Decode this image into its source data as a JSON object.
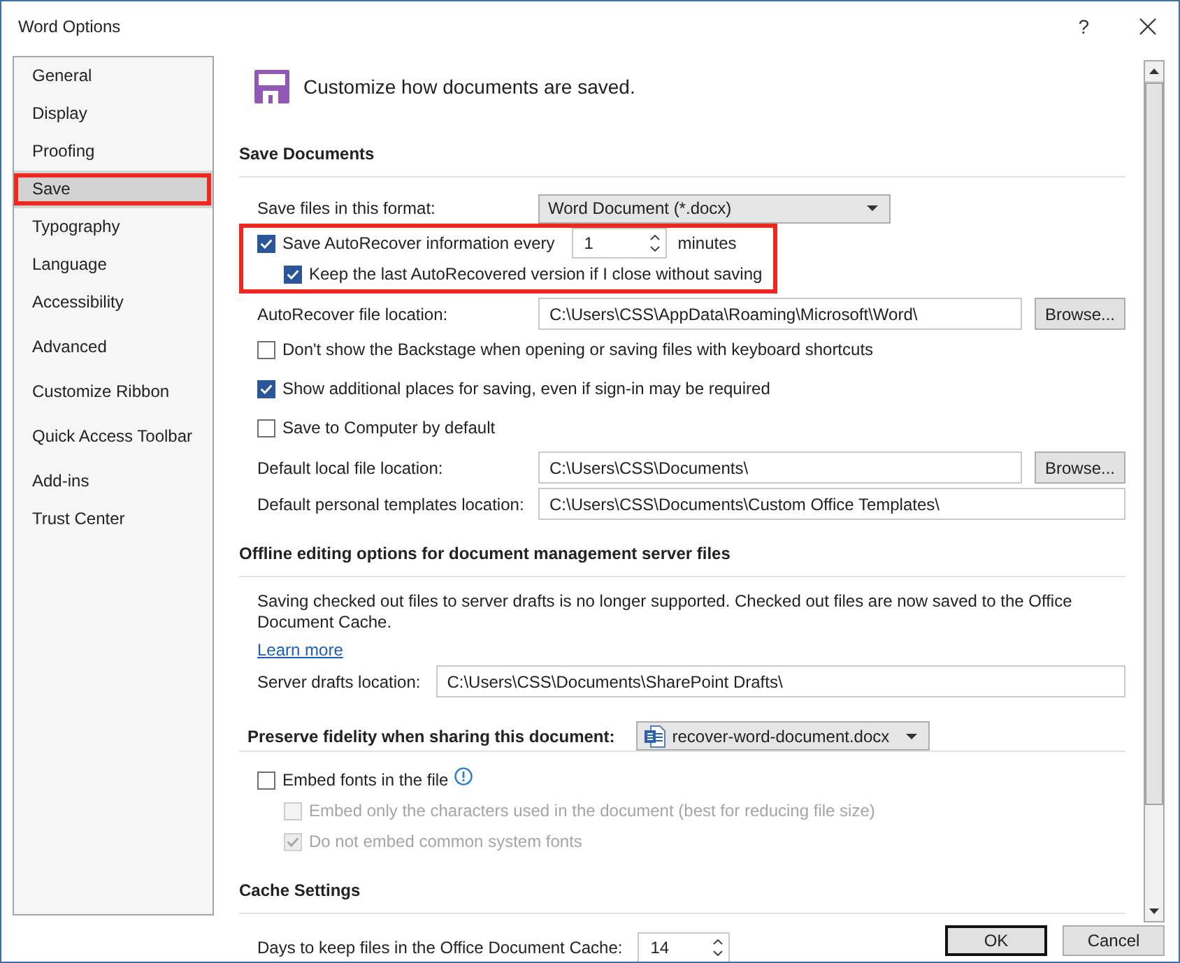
{
  "window": {
    "title": "Word Options",
    "help": "?"
  },
  "sidebar": {
    "groups": [
      {
        "items": [
          {
            "label": "General",
            "selected": false,
            "highlighted": false
          },
          {
            "label": "Display",
            "selected": false,
            "highlighted": false
          },
          {
            "label": "Proofing",
            "selected": false,
            "highlighted": false
          },
          {
            "label": "Save",
            "selected": true,
            "highlighted": true
          },
          {
            "label": "Typography",
            "selected": false,
            "highlighted": false
          },
          {
            "label": "Language",
            "selected": false,
            "highlighted": false
          },
          {
            "label": "Accessibility",
            "selected": false,
            "highlighted": false
          }
        ]
      },
      {
        "items": [
          {
            "label": "Advanced",
            "selected": false,
            "highlighted": false
          }
        ]
      },
      {
        "items": [
          {
            "label": "Customize Ribbon",
            "selected": false,
            "highlighted": false
          }
        ]
      },
      {
        "items": [
          {
            "label": "Quick Access Toolbar",
            "selected": false,
            "highlighted": false
          }
        ]
      },
      {
        "items": [
          {
            "label": "Add-ins",
            "selected": false,
            "highlighted": false
          },
          {
            "label": "Trust Center",
            "selected": false,
            "highlighted": false
          }
        ]
      }
    ]
  },
  "content": {
    "heading": "Customize how documents are saved.",
    "sections": [
      {
        "title": "Save Documents",
        "rows": [
          {
            "kind": "select",
            "label": "Save files in this format:",
            "value": "Word Document (*.docx)"
          },
          {
            "kind": "checkbox",
            "label": "Save AutoRecover information every",
            "checked": true,
            "disabled": false,
            "highlighted": true,
            "spinner": {
              "value": "1",
              "unit": "minutes"
            },
            "children": [
              {
                "kind": "checkbox",
                "label": "Keep the last AutoRecovered version if I close without saving",
                "checked": true,
                "disabled": false
              }
            ]
          },
          {
            "kind": "path",
            "label": "AutoRecover file location:",
            "value": "C:\\Users\\CSS\\AppData\\Roaming\\Microsoft\\Word\\",
            "button": "Browse..."
          },
          {
            "kind": "checkbox",
            "label": "Don't show the Backstage when opening or saving files with keyboard shortcuts",
            "checked": false,
            "disabled": false,
            "highlighted": false
          },
          {
            "kind": "checkbox",
            "label": "Show additional places for saving, even if sign-in may be required",
            "checked": true,
            "disabled": false,
            "highlighted": false
          },
          {
            "kind": "checkbox",
            "label": "Save to Computer by default",
            "checked": false,
            "disabled": false,
            "highlighted": false
          },
          {
            "kind": "path",
            "label": "Default local file location:",
            "value": "C:\\Users\\CSS\\Documents\\",
            "button": "Browse..."
          },
          {
            "kind": "path",
            "label": "Default personal templates location:",
            "value": "C:\\Users\\CSS\\Documents\\Custom Office Templates\\"
          }
        ]
      },
      {
        "title": "Offline editing options for document management server files",
        "rows": [
          {
            "kind": "paragraph",
            "text": "Saving checked out files to server drafts is no longer supported. Checked out files are now saved to the Office Document Cache."
          },
          {
            "kind": "link",
            "text": "Learn more"
          },
          {
            "kind": "path",
            "label": "Server drafts location:",
            "value": "C:\\Users\\CSS\\Documents\\SharePoint Drafts\\"
          }
        ]
      },
      {
        "title": "Preserve fidelity when sharing this document:",
        "select": {
          "value": "recover-word-document.docx"
        },
        "rows": [
          {
            "kind": "checkbox",
            "label": "Embed fonts in the file",
            "checked": false,
            "disabled": false,
            "highlighted": false,
            "info": true,
            "children": [
              {
                "kind": "checkbox",
                "label": "Embed only the characters used in the document (best for reducing file size)",
                "checked": false,
                "disabled": true
              },
              {
                "kind": "checkbox",
                "label": "Do not embed common system fonts",
                "checked": true,
                "disabled": true
              }
            ]
          }
        ]
      },
      {
        "title": "Cache Settings",
        "rows": [
          {
            "kind": "spinner",
            "label": "Days to keep files in the Office Document Cache:",
            "value": "14"
          }
        ]
      }
    ]
  },
  "buttons": [
    {
      "label": "OK",
      "default": true
    },
    {
      "label": "Cancel",
      "default": false
    }
  ]
}
